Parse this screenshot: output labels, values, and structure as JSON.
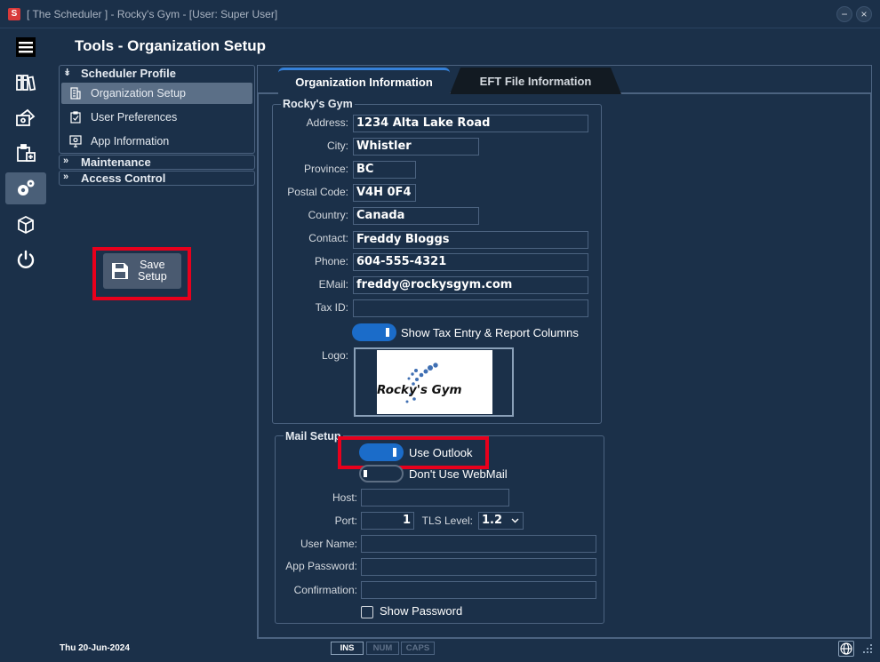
{
  "window": {
    "title": "[ The Scheduler ] - Rocky's Gym - [User: Super User]",
    "app_icon_letter": "S",
    "minimize_glyph": "−",
    "close_glyph": "×"
  },
  "page": {
    "title": "Tools - Organization Setup"
  },
  "icon_nav": [
    {
      "name": "menu-icon"
    },
    {
      "name": "binders-icon"
    },
    {
      "name": "payment-icon"
    },
    {
      "name": "clipboard-icon"
    },
    {
      "name": "settings-icon",
      "active": true
    },
    {
      "name": "package-icon"
    },
    {
      "name": "power-icon"
    }
  ],
  "tree": {
    "sections": [
      {
        "label": "Scheduler Profile",
        "expanded": true,
        "items": [
          {
            "label": "Organization Setup",
            "icon": "building-icon",
            "selected": true
          },
          {
            "label": "User Preferences",
            "icon": "clipboard-check-icon"
          },
          {
            "label": "App Information",
            "icon": "monitor-info-icon"
          }
        ]
      },
      {
        "label": "Maintenance",
        "expanded": false
      },
      {
        "label": "Access Control",
        "expanded": false
      }
    ],
    "expanded_chevron": "»",
    "collapsed_chevron": "»"
  },
  "save_button": {
    "line1": "Save",
    "line2": "Setup"
  },
  "tabs": [
    {
      "label": "Organization Information",
      "active": true
    },
    {
      "label": "EFT File Information",
      "active": false
    }
  ],
  "org": {
    "group_title": "Rocky's Gym",
    "address_label": "Address:",
    "address": "1234 Alta Lake Road",
    "city_label": "City:",
    "city": "Whistler",
    "province_label": "Province:",
    "province": "BC",
    "postal_label": "Postal Code:",
    "postal": "V4H 0F4",
    "country_label": "Country:",
    "country": "Canada",
    "contact_label": "Contact:",
    "contact": "Freddy Bloggs",
    "phone_label": "Phone:",
    "phone": "604-555-4321",
    "email_label": "EMail:",
    "email": "freddy@rockysgym.com",
    "taxid_label": "Tax ID:",
    "taxid": "",
    "tax_toggle_label": "Show Tax Entry & Report Columns",
    "tax_toggle_on": true,
    "logo_label": "Logo:",
    "logo_text": "Rocky's Gym"
  },
  "mail": {
    "group_title": "Mail Setup",
    "outlook_label": "Use Outlook",
    "outlook_on": true,
    "webmail_label": "Don't Use WebMail",
    "webmail_on": false,
    "host_label": "Host:",
    "host": "",
    "port_label": "Port:",
    "port": "1",
    "tls_label": "TLS Level:",
    "tls": "1.2",
    "username_label": "User Name:",
    "username": "",
    "app_password_label": "App Password:",
    "app_password": "",
    "confirmation_label": "Confirmation:",
    "confirmation": "",
    "show_password_label": "Show Password",
    "show_password": false
  },
  "status": {
    "date": "Thu  20-Jun-2024",
    "keys": [
      {
        "label": "INS",
        "on": true
      },
      {
        "label": "NUM",
        "on": false
      },
      {
        "label": "CAPS",
        "on": false
      }
    ]
  },
  "colors": {
    "background": "#1b3049",
    "accent": "#1b6cc9",
    "highlight": "#e8001c",
    "selected": "#5b6f87"
  }
}
